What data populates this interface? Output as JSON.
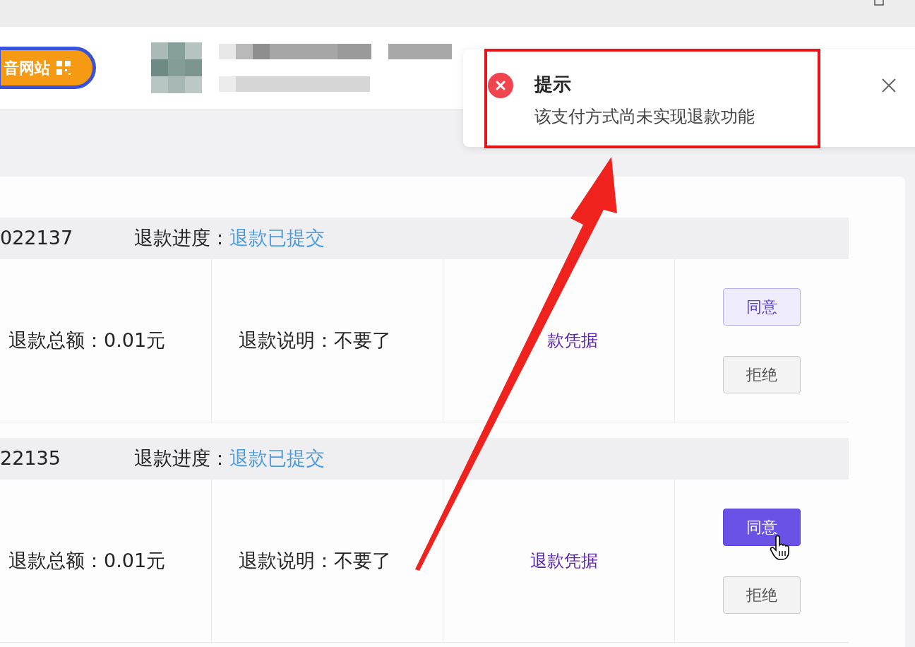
{
  "header": {
    "badge": "音网站"
  },
  "toast": {
    "title": "提示",
    "message": "该支付方式尚未实现退款功能"
  },
  "refunds": [
    {
      "order_no": "022137",
      "progress_label": "退款进度：",
      "progress": "退款已提交",
      "total": "退款总额：0.01元",
      "note": "退款说明：不要了",
      "evidence": "款凭据",
      "buttons": [
        {
          "label": "同意",
          "kind": "approve",
          "hovered": false
        },
        {
          "label": "拒绝",
          "kind": "reject",
          "hovered": false
        }
      ]
    },
    {
      "order_no": "22135",
      "progress_label": "退款进度：",
      "progress": "退款已提交",
      "total": "退款总额：0.01元",
      "note": "退款说明：不要了",
      "evidence": "退款凭据",
      "buttons": [
        {
          "label": "同意",
          "kind": "approve",
          "hovered": true
        },
        {
          "label": "拒绝",
          "kind": "reject",
          "hovered": false
        }
      ]
    }
  ]
}
